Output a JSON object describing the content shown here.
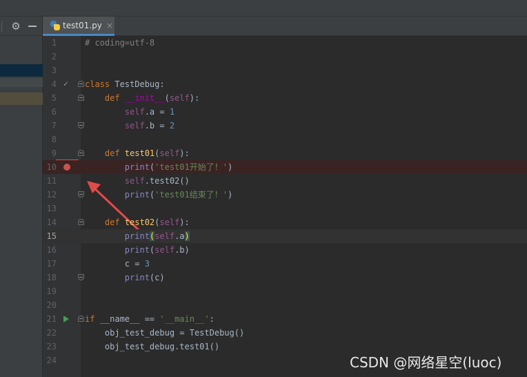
{
  "tab": {
    "filename": "test01.py",
    "close_glyph": "×"
  },
  "toolbar": {
    "settings_icon": "gear-icon",
    "settings_glyph": "⚙",
    "collapse_icon": "minus-icon"
  },
  "gutter": {
    "breakpoint_line": 10,
    "caret_line": 15,
    "run_line": 21,
    "check_line": 4,
    "check_glyph": "✓"
  },
  "lines": [
    {
      "n": "1",
      "code": [
        {
          "t": "# coding=utf-8",
          "c": "cmt"
        }
      ]
    },
    {
      "n": "2",
      "code": []
    },
    {
      "n": "3",
      "code": []
    },
    {
      "n": "4",
      "code": [
        {
          "t": "class ",
          "c": "kw"
        },
        {
          "t": "TestDebug:",
          "c": ""
        }
      ]
    },
    {
      "n": "5",
      "code": [
        {
          "t": "    def ",
          "c": "kw"
        },
        {
          "t": "__init__",
          "c": "magic"
        },
        {
          "t": "(",
          "c": ""
        },
        {
          "t": "self",
          "c": "self"
        },
        {
          "t": "):",
          "c": ""
        }
      ]
    },
    {
      "n": "6",
      "code": [
        {
          "t": "        ",
          "c": ""
        },
        {
          "t": "self",
          "c": "self"
        },
        {
          "t": ".a = ",
          "c": ""
        },
        {
          "t": "1",
          "c": "num"
        }
      ]
    },
    {
      "n": "7",
      "code": [
        {
          "t": "        ",
          "c": ""
        },
        {
          "t": "self",
          "c": "self"
        },
        {
          "t": ".b = ",
          "c": ""
        },
        {
          "t": "2",
          "c": "num"
        }
      ]
    },
    {
      "n": "8",
      "code": []
    },
    {
      "n": "9",
      "code": [
        {
          "t": "    def ",
          "c": "kw"
        },
        {
          "t": "test01",
          "c": "fn"
        },
        {
          "t": "(",
          "c": ""
        },
        {
          "t": "self",
          "c": "self"
        },
        {
          "t": "):",
          "c": ""
        }
      ]
    },
    {
      "n": "10",
      "code": [
        {
          "t": "        ",
          "c": ""
        },
        {
          "t": "print",
          "c": "bi"
        },
        {
          "t": "(",
          "c": ""
        },
        {
          "t": "'test01开始了！'",
          "c": "str"
        },
        {
          "t": ")",
          "c": ""
        }
      ]
    },
    {
      "n": "11",
      "code": [
        {
          "t": "        ",
          "c": ""
        },
        {
          "t": "self",
          "c": "self"
        },
        {
          "t": ".test02()",
          "c": ""
        }
      ]
    },
    {
      "n": "12",
      "code": [
        {
          "t": "        ",
          "c": ""
        },
        {
          "t": "print",
          "c": "bi"
        },
        {
          "t": "(",
          "c": ""
        },
        {
          "t": "'test01结束了！'",
          "c": "str"
        },
        {
          "t": ")",
          "c": ""
        }
      ]
    },
    {
      "n": "13",
      "code": []
    },
    {
      "n": "14",
      "code": [
        {
          "t": "    def ",
          "c": "kw"
        },
        {
          "t": "test02",
          "c": "fn"
        },
        {
          "t": "(",
          "c": ""
        },
        {
          "t": "self",
          "c": "self"
        },
        {
          "t": "):",
          "c": ""
        }
      ]
    },
    {
      "n": "15",
      "code": [
        {
          "t": "        ",
          "c": ""
        },
        {
          "t": "print",
          "c": "bi"
        },
        {
          "t": "(",
          "c": "match"
        },
        {
          "t": "self",
          "c": "self"
        },
        {
          "t": ".a",
          "c": ""
        },
        {
          "t": ")",
          "c": "match"
        }
      ]
    },
    {
      "n": "16",
      "code": [
        {
          "t": "        ",
          "c": ""
        },
        {
          "t": "print",
          "c": "bi"
        },
        {
          "t": "(",
          "c": ""
        },
        {
          "t": "self",
          "c": "self"
        },
        {
          "t": ".b)",
          "c": ""
        }
      ]
    },
    {
      "n": "17",
      "code": [
        {
          "t": "        c = ",
          "c": ""
        },
        {
          "t": "3",
          "c": "num"
        }
      ]
    },
    {
      "n": "18",
      "code": [
        {
          "t": "        ",
          "c": ""
        },
        {
          "t": "print",
          "c": "bi"
        },
        {
          "t": "(c)",
          "c": ""
        }
      ]
    },
    {
      "n": "19",
      "code": []
    },
    {
      "n": "20",
      "code": []
    },
    {
      "n": "21",
      "code": [
        {
          "t": "if ",
          "c": "kw"
        },
        {
          "t": "__name__ == ",
          "c": ""
        },
        {
          "t": "'__main__'",
          "c": "str"
        },
        {
          "t": ":",
          "c": ""
        }
      ]
    },
    {
      "n": "22",
      "code": [
        {
          "t": "    obj_test_debug = TestDebug()",
          "c": ""
        }
      ]
    },
    {
      "n": "23",
      "code": [
        {
          "t": "    obj_test_debug.test01()",
          "c": ""
        }
      ]
    },
    {
      "n": "24",
      "code": []
    }
  ],
  "folds": {
    "start": [
      4,
      5,
      9,
      14,
      21
    ],
    "end": [
      7,
      12,
      18
    ]
  },
  "watermark": "CSDN @网络星空(luoc)",
  "colors": {
    "breakpoint": "#c75450",
    "annotation": "#e34a4a",
    "run": "#499c54",
    "tab_accent": "#4a88c7"
  }
}
